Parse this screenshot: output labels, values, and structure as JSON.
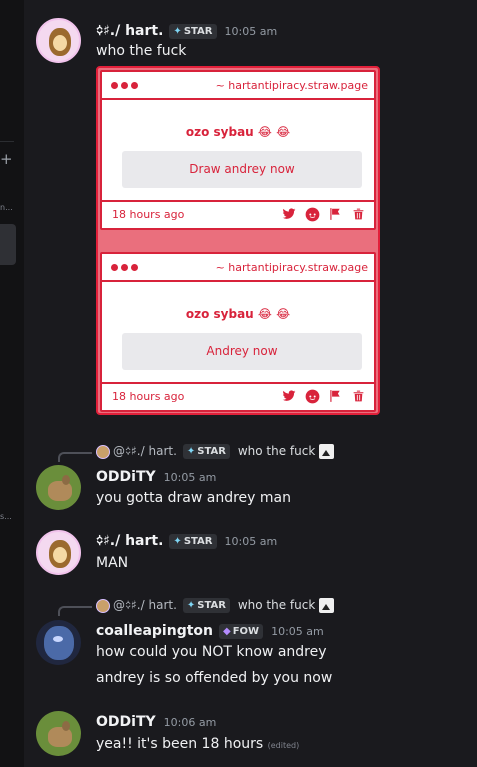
{
  "messages": [
    {
      "author": "᨟♯./ hart.",
      "tag": "STAR",
      "time": "10:05 am",
      "text": "who the fuck",
      "embed": {
        "cards": [
          {
            "url": "~ hartantipiracy.straw.page",
            "title": "ozo sybau 😂 😂",
            "button": "Draw andrey now",
            "ago": "18 hours ago"
          },
          {
            "url": "~ hartantipiracy.straw.page",
            "title": "ozo sybau 😂 😂",
            "button": "Andrey now",
            "ago": "18 hours ago"
          }
        ]
      }
    },
    {
      "reply": {
        "prefix": "@",
        "author": "᨟♯./ hart.",
        "tag": "STAR",
        "text": "who the fuck"
      },
      "author": "ODDiTY",
      "time": "10:05 am",
      "text": "you gotta draw andrey man"
    },
    {
      "author": "᨟♯./ hart.",
      "tag": "STAR",
      "time": "10:05 am",
      "text": "MAN"
    },
    {
      "reply": {
        "prefix": "@",
        "author": "᨟♯./ hart.",
        "tag": "STAR",
        "text": "who the fuck"
      },
      "author": "coalleapington",
      "tag": "FOW",
      "time": "10:05 am",
      "text": "how could you NOT know andrey",
      "text2": "andrey is so offended by you now"
    },
    {
      "author": "ODDiTY",
      "time": "10:06 am",
      "text": "yea!! it's been 18 hours",
      "edited": "(edited)"
    }
  ],
  "icons": {
    "twitter": "twitter-icon",
    "reddit": "reddit-icon",
    "flag": "flag-icon",
    "trash": "trash-icon"
  },
  "colors": {
    "accent": "#d8233b",
    "embed_bg": "#ea6f7d",
    "background": "#1a1a1e"
  }
}
